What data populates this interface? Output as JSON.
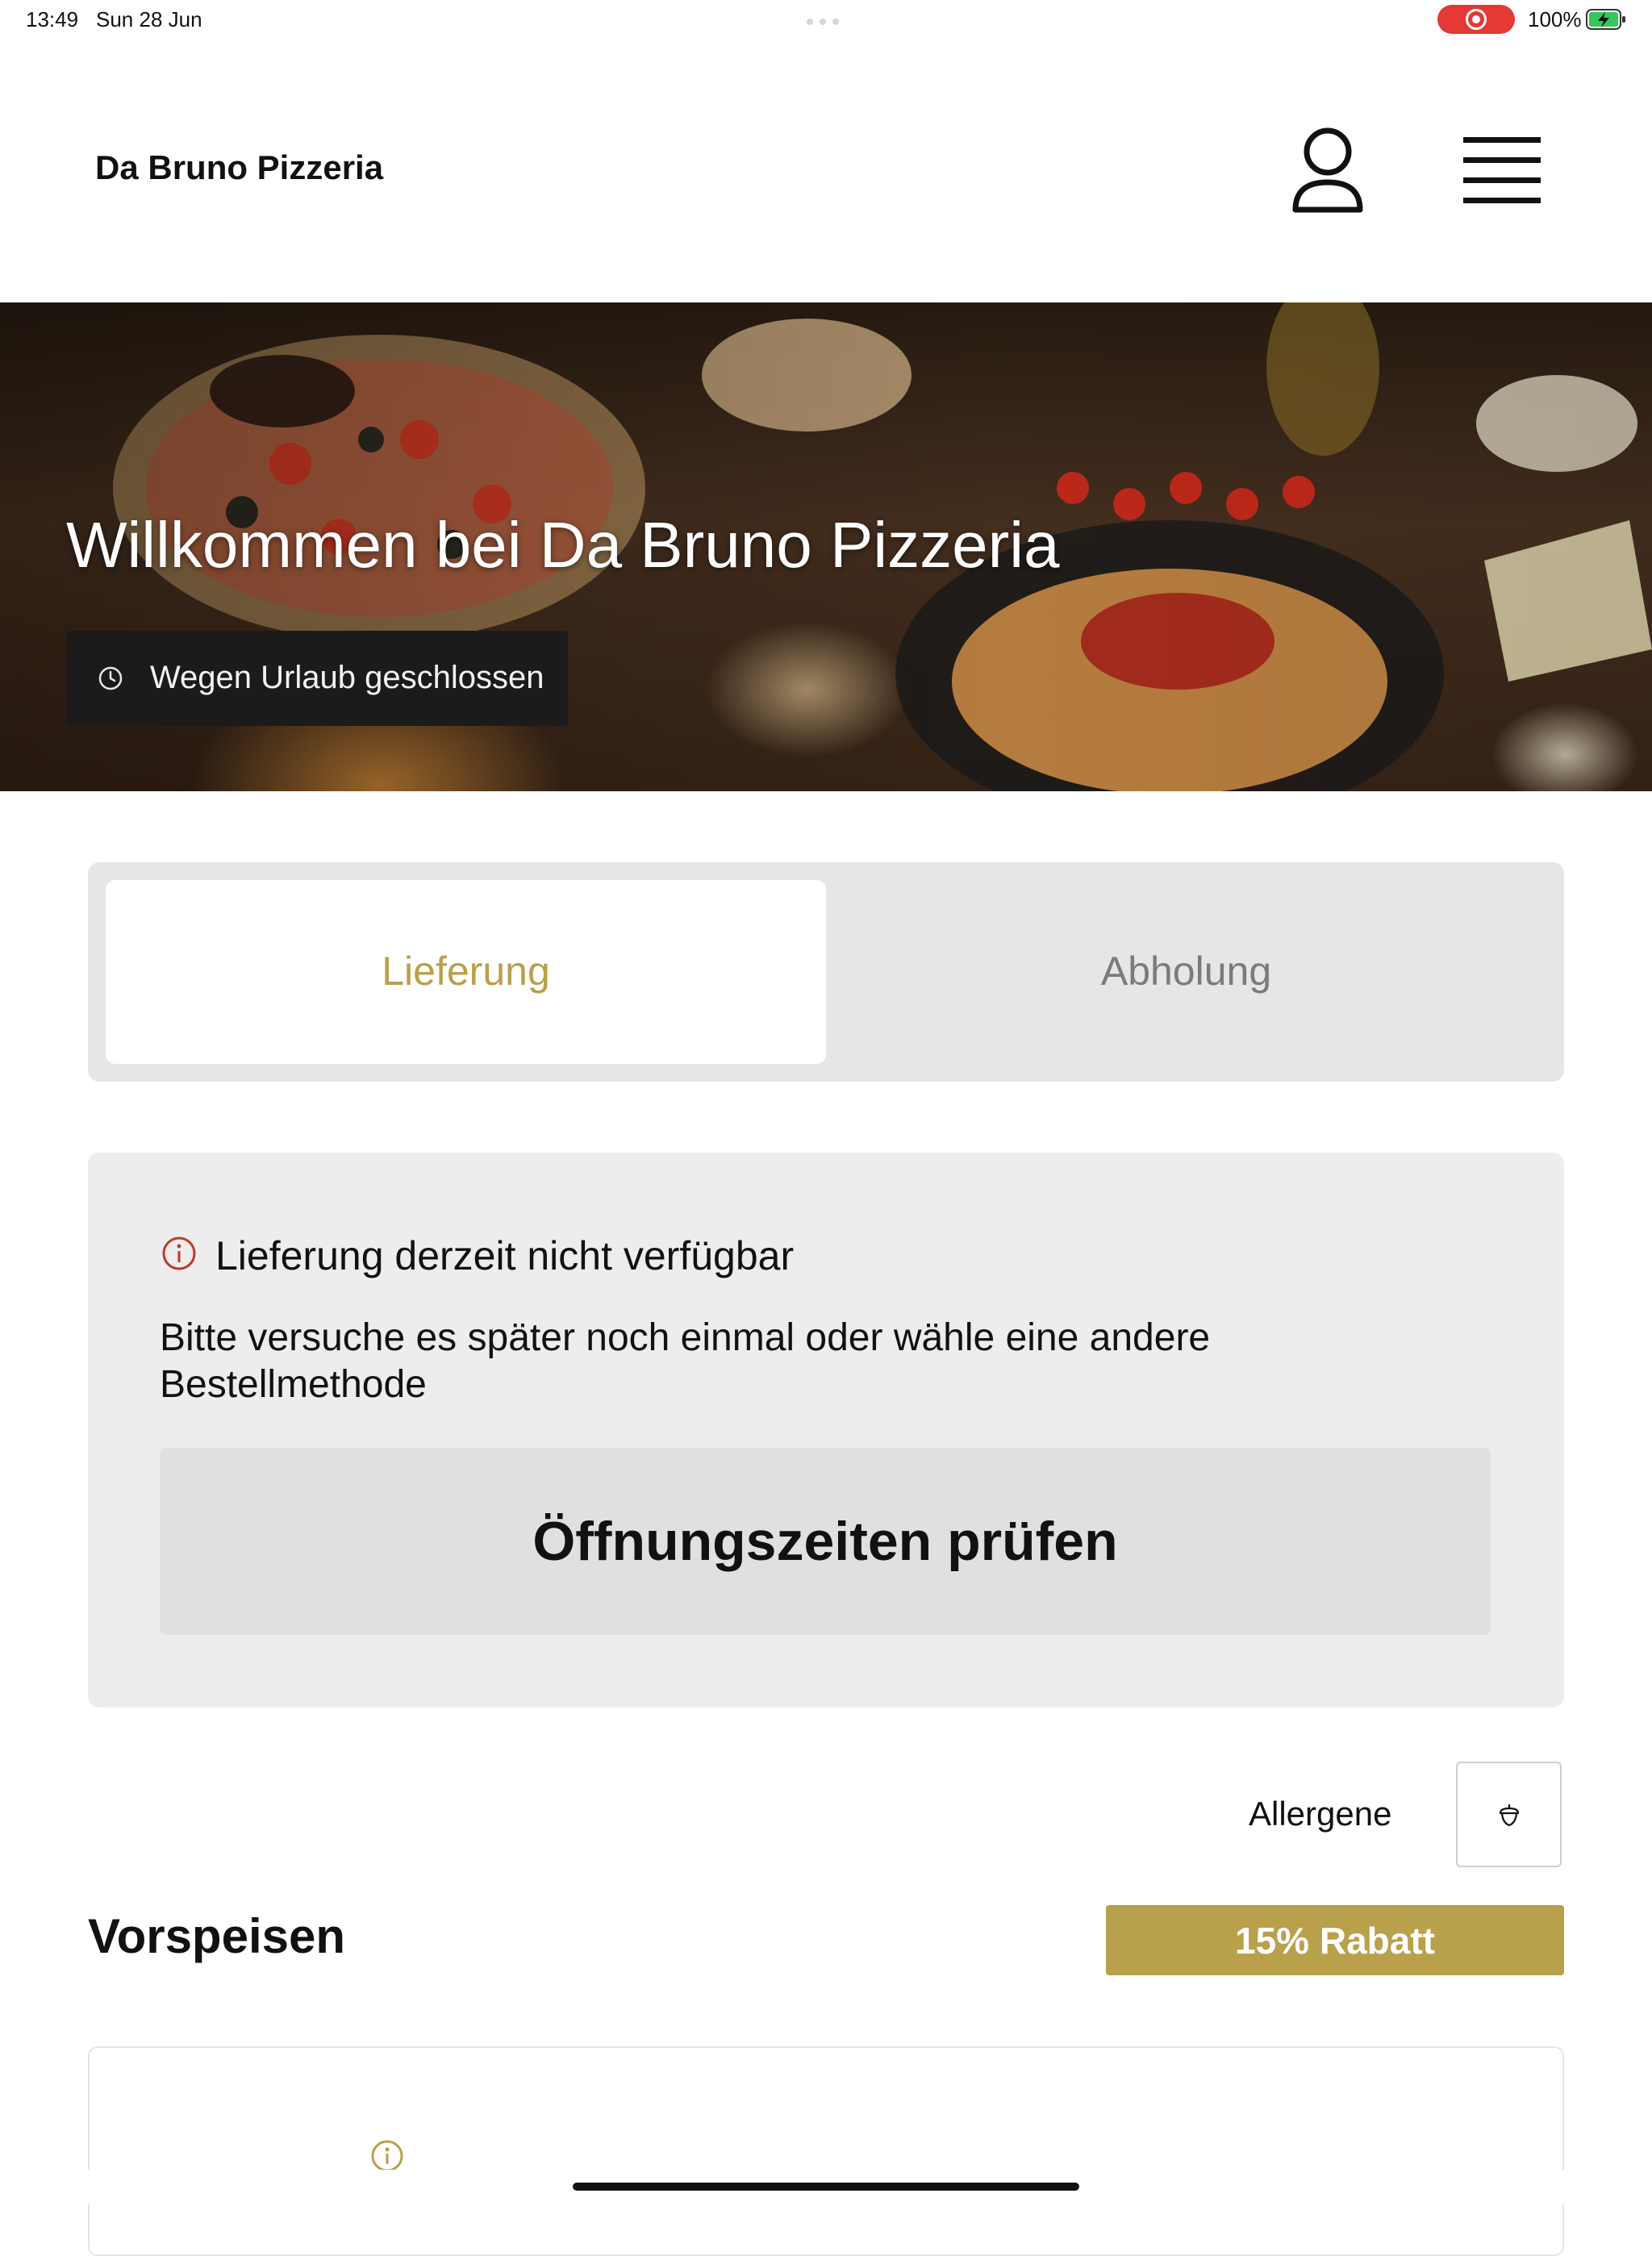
{
  "status_bar": {
    "time": "13:49",
    "date": "Sun 28 Jun",
    "battery_percent": "100%",
    "battery_level": 1.0,
    "charging": true,
    "screen_recording": true
  },
  "header": {
    "brand": "Da Bruno Pizzeria",
    "account_icon": "person-icon",
    "menu_icon": "hamburger-menu-icon"
  },
  "hero": {
    "title": "Willkommen bei Da Bruno Pizzeria",
    "status_badge": "Wegen Urlaub geschlossen",
    "status_icon": "clock-icon"
  },
  "order_method": {
    "tabs": [
      {
        "label": "Lieferung",
        "active": true
      },
      {
        "label": "Abholung",
        "active": false
      }
    ],
    "active_color": "#b9a04b",
    "inactive_color": "#7b7b7b"
  },
  "notice": {
    "icon": "info-icon",
    "icon_color": "#c0392b",
    "title": "Lieferung derzeit nicht verfügbar",
    "body": "Bitte versuche es später noch einmal oder wähle eine andere Bestellmethode",
    "button_label": "Öffnungszeiten prüfen"
  },
  "allergens": {
    "label": "Allergene",
    "icon": "acorn-icon"
  },
  "menu": {
    "section_title": "Vorspeisen",
    "discount_badge": "15% Rabatt",
    "accent_color": "#b9a04b"
  }
}
